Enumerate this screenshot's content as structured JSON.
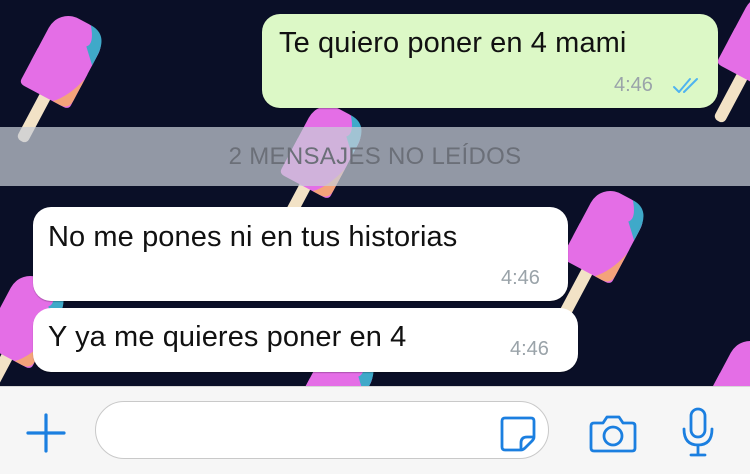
{
  "messages": [
    {
      "direction": "outgoing",
      "text": "Te quiero poner en 4 mami",
      "time": "4:46",
      "status": "read"
    },
    {
      "direction": "incoming",
      "text": "No me pones ni en tus historias",
      "time": "4:46"
    },
    {
      "direction": "incoming",
      "text": "Y ya me quieres poner en 4",
      "time": "4:46"
    }
  ],
  "unread_banner": "2 MENSAJES NO LEÍDOS",
  "input_bar": {
    "message_value": "",
    "icons": [
      "plus-icon",
      "sticker-icon",
      "camera-icon",
      "microphone-icon"
    ]
  },
  "colors": {
    "wallpaper": "#0a0f27",
    "outgoing_bubble": "#dcf8c6",
    "incoming_bubble": "#ffffff",
    "accent": "#1b7fe0",
    "read_ticks": "#4fb3f0",
    "popsicle": "#e46ee6",
    "popsicle_tip": "#3fa9c9",
    "stick": "#f2e2c6"
  }
}
